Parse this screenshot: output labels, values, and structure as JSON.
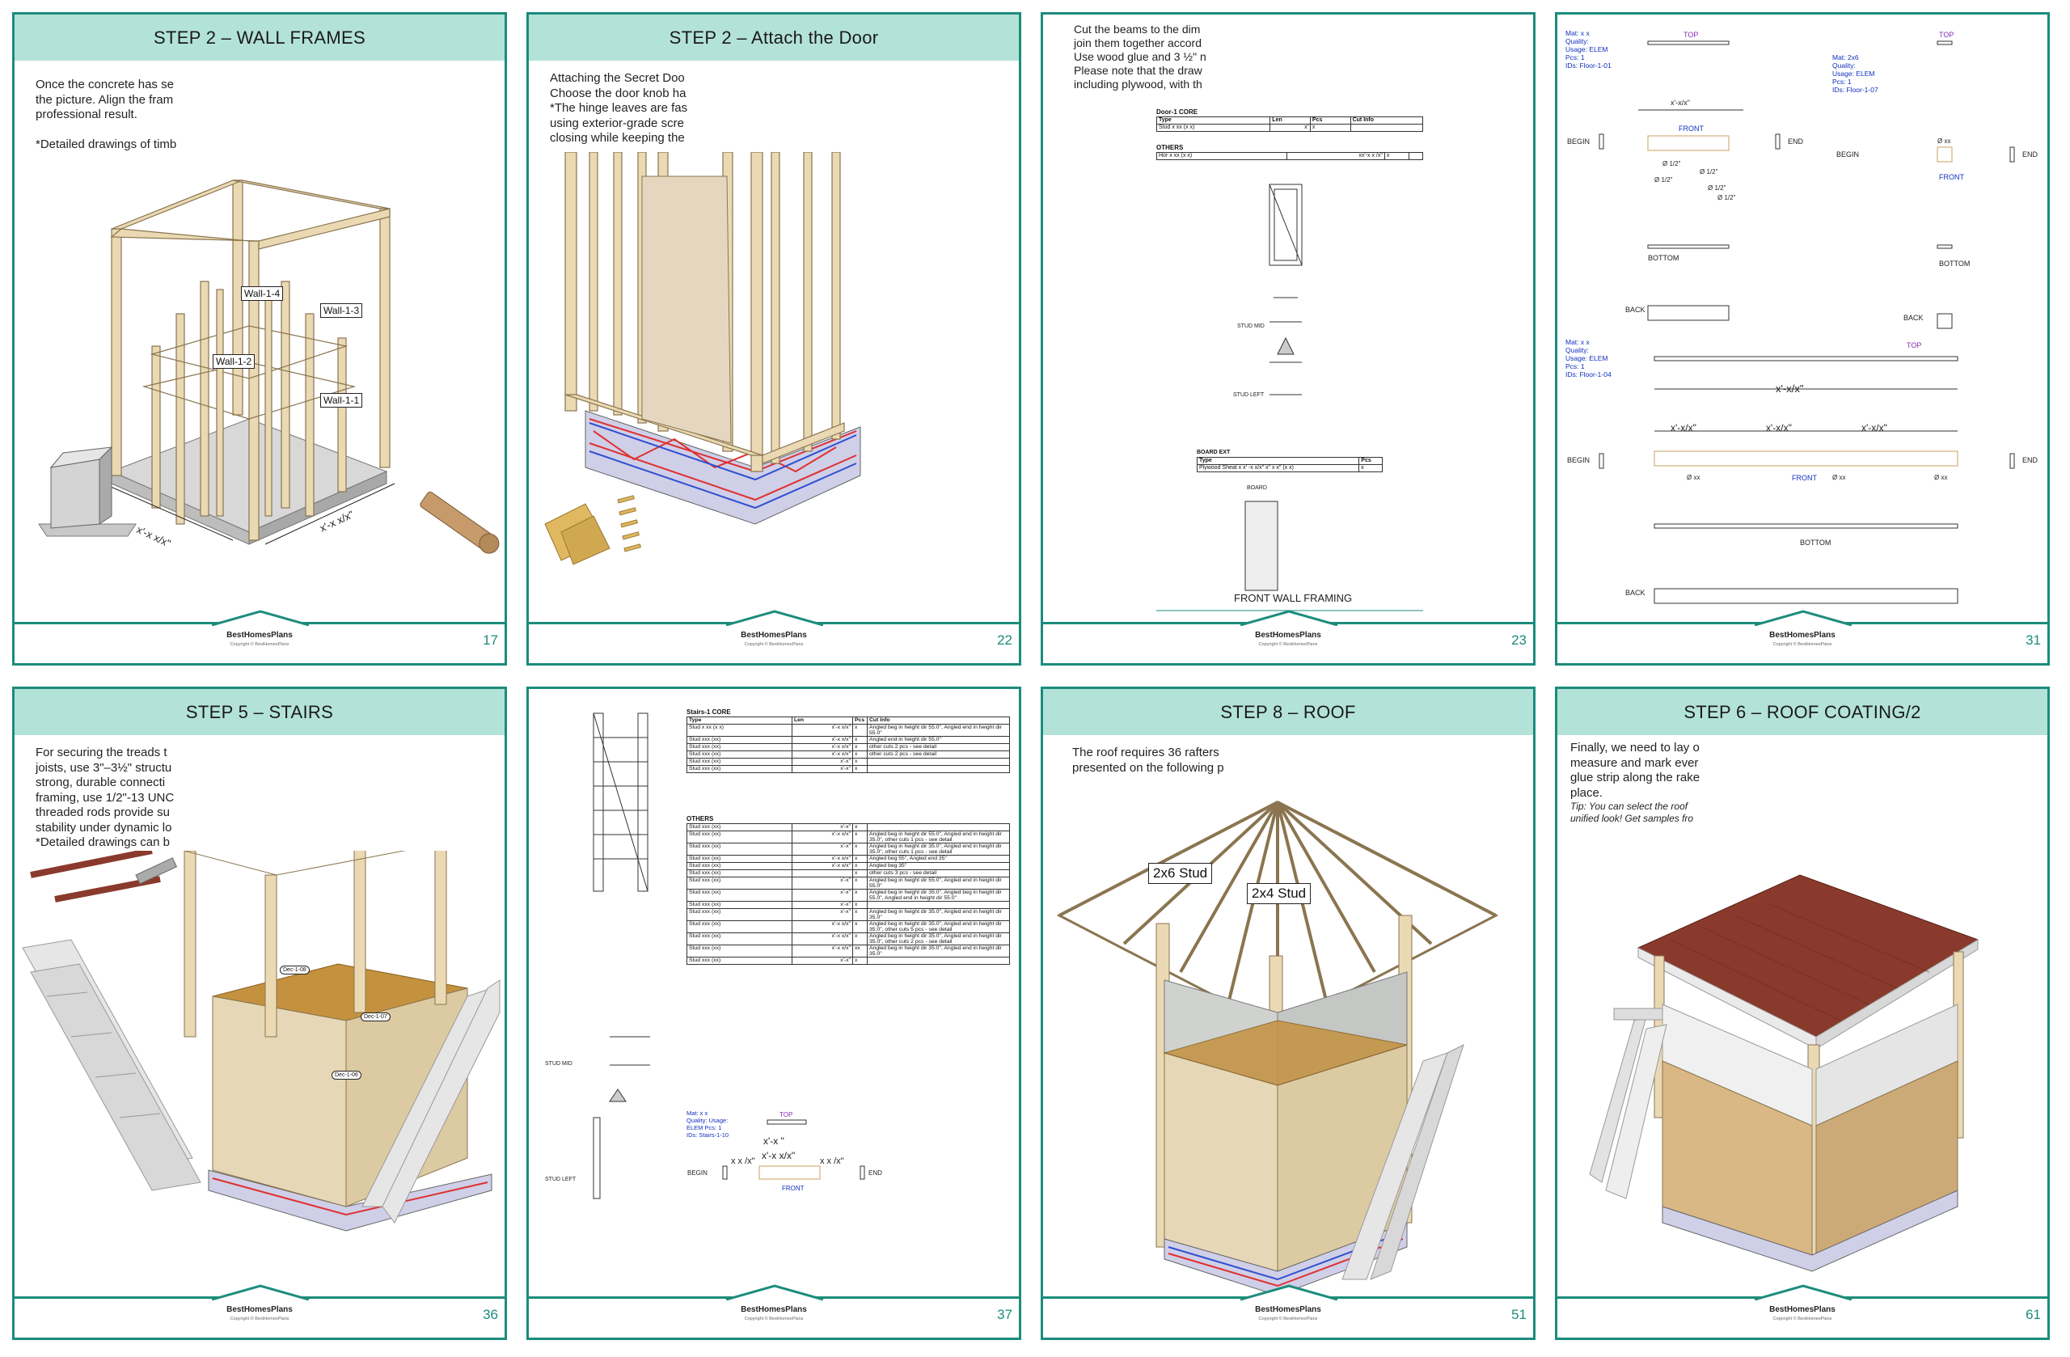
{
  "pages": [
    {
      "title": "STEP 2 – WALL FRAMES",
      "intro": "Once the concrete has se\nthe picture. Align the fram\nprofessional result.\n\n*Detailed drawings of timb",
      "callouts": [
        "Wall-1-4",
        "Wall-1-3",
        "Wall-1-2",
        "Wall-1-1"
      ],
      "dims": [
        "x'-x x/x\"",
        "x'-x x/x\""
      ],
      "brand": "BestHomesPlans",
      "copyright": "Copyright © BestHomesPlans",
      "number": "17"
    },
    {
      "title": "STEP 2 – Attach the Door",
      "intro": "Attaching the Secret Doo\nChoose the door knob ha\n*The hinge leaves are fas\nusing exterior-grade scre\nclosing while keeping the",
      "brand": "BestHomesPlans",
      "copyright": "Copyright © BestHomesPlans",
      "number": "22"
    },
    {
      "intro": "Cut the beams to the dim\njoin them together accord\nUse wood glue and 3 ½\" n\nPlease note that the draw\nincluding plywood, with th",
      "core_title": "Door-1 CORE",
      "core_headers": [
        "Type",
        "Len",
        "Pcs",
        "Cut Info"
      ],
      "core_rows": [
        [
          "Stud x xx (x x)",
          "x'",
          "x",
          ""
        ]
      ],
      "others_title": "OTHERS",
      "others_rows": [
        [
          "Hor x xx (x x)",
          "xx'-x x /x\"",
          "x",
          ""
        ]
      ],
      "board_title": "BOARD EXT",
      "board_headers": [
        "Type",
        "Pcs"
      ],
      "board_rows": [
        [
          "Plywood Sheat x x' -x x/x\" x\" x x\" (x x)",
          "x"
        ]
      ],
      "labels": [
        "STUD MID",
        "STUD LEFT",
        "BOARD"
      ],
      "plate": "FRONT WALL FRAMING",
      "brand": "BestHomesPlans",
      "copyright": "Copyright © BestHomesPlans",
      "number": "23"
    },
    {
      "spec1": "Mat: x x\nQuality:\nUsage: ELEM\nPcs: 1\nIDs: Floor-1-01",
      "spec2": "Mat: 2x6\nQuality:\nUsage: ELEM\nPcs: 1\nIDs: Floor-1-07",
      "spec3": "Mat: x x\nQuality:\nUsage: ELEM\nPcs: 1\nIDs: Floor-1-04",
      "views": [
        "TOP",
        "FRONT",
        "BOTTOM",
        "BACK",
        "BEGIN",
        "END"
      ],
      "dim_main": "x'-x/x\"",
      "dim_seg": "x'-x/x\"",
      "holes": [
        "Ø 1/2\"",
        "Ø 1/2\"",
        "Ø 1/2\"",
        "Ø 1/2\"",
        "Ø 1/2\"",
        "Ø 1/2\""
      ],
      "hole_xx": "Ø xx",
      "brand": "BestHomesPlans",
      "copyright": "Copyright © BestHomesPlans",
      "number": "31"
    },
    {
      "title": "STEP 5 – STAIRS",
      "intro": "For securing the treads t\njoists, use 3\"–3½\" structu\nstrong, durable connecti\nframing, use 1/2\"-13 UNC\nthreaded rods provide su\nstability under dynamic lo\n*Detailed drawings can b",
      "callouts": [
        "Dec-1-08",
        "Dec-1-07",
        "Dec-1-06"
      ],
      "brand": "BestHomesPlans",
      "copyright": "Copyright © BestHomesPlans",
      "number": "36"
    },
    {
      "core_title": "Stairs-1 CORE",
      "headers": [
        "Type",
        "Len",
        "Pcs",
        "Cut Info"
      ],
      "core_rows": [
        [
          "Stud x xx (x x)",
          "x'-x x/x\"",
          "x",
          "Angled beg in height dir 55.0\", Angled end in height dir 55.0\""
        ],
        [
          "Stud xxx (xx)",
          "x'-x x/x\"",
          "x",
          "Angled end in height dir 55.0\""
        ],
        [
          "Stud xxx (xx)",
          "x'-x x/x\"",
          "x",
          "other cuts 2 pcs - see detail"
        ],
        [
          "Stud xxx (xx)",
          "x'-x x/x\"",
          "x",
          "other cuts 2 pcs - see detail"
        ],
        [
          "Stud xxx (xx)",
          "x'-x\"",
          "x",
          ""
        ],
        [
          "Stud xxx (xx)",
          "x'-x\"",
          "x",
          ""
        ]
      ],
      "others_title": "OTHERS",
      "others_rows": [
        [
          "Stud xxx (xx)",
          "x'-x\"",
          "x",
          ""
        ],
        [
          "Stud xxx (xx)",
          "x'-x x/x\"",
          "x",
          "Angled beg in height dir 55.0\", Angled end in height dir 35.0\", other cuts 1 pcs - see detail"
        ],
        [
          "Stud xxx (xx)",
          "x'-x\"",
          "x",
          "Angled beg in height dir 35.0\", Angled end in height dir 35.0\", other cuts 1 pcs - see detail"
        ],
        [
          "Stud xxx (xx)",
          "x'-x x/x\"",
          "x",
          "Angled beg 55\", Angled end 35\""
        ],
        [
          "Stud xxx (xx)",
          "x'-x x/x\"",
          "x",
          "Angled beg 35\""
        ],
        [
          "Stud xxx (xx)",
          "",
          "x",
          "other cuts 3 pcs - see detail"
        ],
        [
          "Stud xxx (xx)",
          "x'-x\"",
          "x",
          "Angled beg in height dir 55.0\", Angled end in height dir 55.0\""
        ],
        [
          "Stud xxx (xx)",
          "x'-x\"",
          "x",
          "Angled beg in height dir 35.0\", Angled beg in height dir 55.0\", Angled end in height dir 55.0\""
        ],
        [
          "Stud xxx (xx)",
          "x'-x\"",
          "x",
          ""
        ],
        [
          "Stud xxx (xx)",
          "x'-x\"",
          "x",
          "Angled beg in height dir 35.0\", Angled end in height dir 35.0\""
        ],
        [
          "Stud xxx (xx)",
          "x'-x x/x\"",
          "x",
          "Angled beg in height dir 35.0\", Angled end in height dir 35.0\", other cuts 5 pcs - see detail"
        ],
        [
          "Stud xxx (xx)",
          "x'-x x/x\"",
          "x",
          "Angled beg in height dir 35.0\", Angled end in height dir 35.0\", other cuts 2 pcs - see detail"
        ],
        [
          "Stud xxx (xx)",
          "x'-x x/x\"",
          "xx",
          "Angled beg in height dir 35.0\", Angled end in height dir 35.0\""
        ],
        [
          "Stud xxx (xx)",
          "x'-x\"",
          "x",
          ""
        ]
      ],
      "spec": "Mat: x x\nQuality: Usage:\nELEM Pcs: 1\nIDs: Stairs-1-10",
      "labels": [
        "STUD MID",
        "STUD LEFT",
        "BEGIN",
        "END",
        "TOP",
        "FRONT"
      ],
      "dim1": "x'-x \"",
      "dim2": "x'-x x/x\"",
      "dim3": "x x /x\"",
      "dim4": "x x /x\"",
      "brand": "BestHomesPlans",
      "copyright": "Copyright © BestHomesPlans",
      "number": "37"
    },
    {
      "title": "STEP 8 – ROOF",
      "intro": "The roof requires 36 rafters\npresented on the following p",
      "callouts": [
        "2x6 Stud",
        "2x4 Stud"
      ],
      "brand": "BestHomesPlans",
      "copyright": "Copyright © BestHomesPlans",
      "number": "51"
    },
    {
      "title": "STEP 6 – ROOF COATING/2",
      "intro": "Finally, we need to lay o\nmeasure and mark ever\nglue strip along the rake\nplace.",
      "tip_label": "Tip:",
      "tip": " You can select the roof\nunified look! Get samples fro",
      "brand": "BestHomesPlans",
      "copyright": "Copyright © BestHomesPlans",
      "number": "61"
    }
  ],
  "colors": {
    "accent": "#1c8c7c",
    "header_bg": "#b3e2d8",
    "wood": "#e8d9b8",
    "rebar_red": "#e03030",
    "rebar_blue": "#3050d0",
    "shingle": "#8a3a2c"
  }
}
